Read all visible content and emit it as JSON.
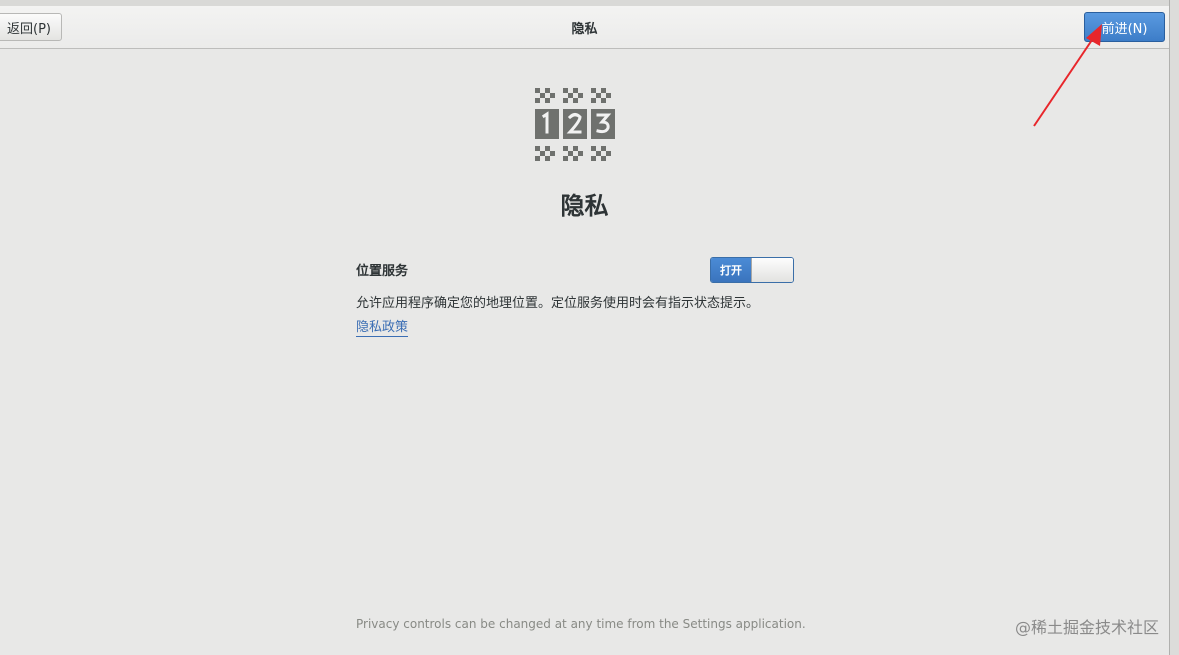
{
  "header": {
    "back_label": "返回(P)",
    "title": "隐私",
    "next_label": "前进(N)"
  },
  "icon": "privacy-123-icon",
  "main": {
    "title": "隐私",
    "location_services": {
      "label": "位置服务",
      "switch_state": "打开",
      "description": "允许应用程序确定您的地理位置。定位服务使用时会有指示状态提示。"
    },
    "policy_link": "隐私政策",
    "footer_note": "Privacy controls can be changed at any time from the Settings application."
  },
  "watermark": "@稀土掘金技术社区",
  "colors": {
    "accent": "#3d7dc8",
    "annotation": "#e8262b",
    "background": "#e8e8e7"
  }
}
